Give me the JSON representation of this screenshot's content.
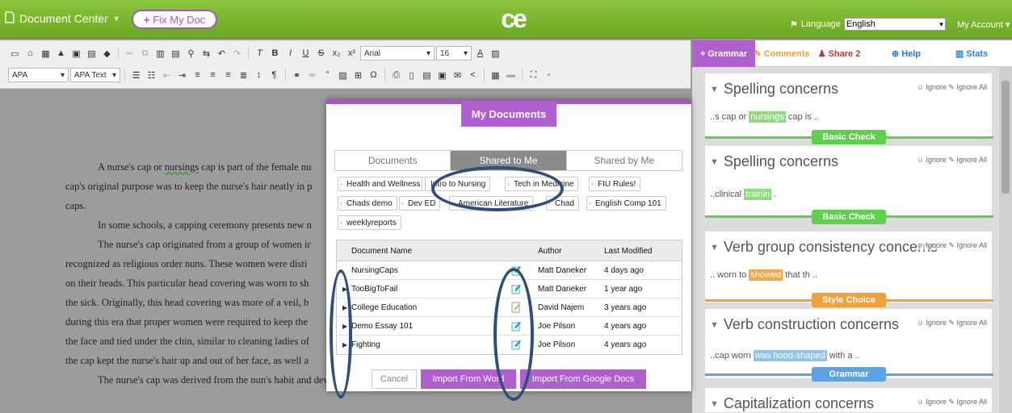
{
  "topbar": {
    "doc_center": "Document Center",
    "fix_button": "Fix My Doc",
    "logo": "ce",
    "language_label": "Language",
    "language_value": "English",
    "account": "My Account"
  },
  "toolbar": {
    "font_name": "Arial",
    "font_size": "16",
    "style_apa": "APA",
    "style_text": "APA Text"
  },
  "editor": {
    "lines": [
      {
        "text_a": "A nurse's cap or ",
        "squig": "nursings",
        "text_b": " cap is part of the female nu"
      },
      {
        "text": "cap's original purpose was to keep the nurse's hair neatly in p"
      },
      {
        "text": "caps."
      },
      {
        "text": "In some schools, a capping ceremony presents new n"
      },
      {
        "text": "The nurse's cap originated from a group of women ir"
      },
      {
        "text": "recognized as religious order nuns. These women were disti"
      },
      {
        "text": "on their heads. This particular head covering was worn to sh"
      },
      {
        "text": "the sick. Originally, this head covering was more of a veil, b"
      },
      {
        "text": "during this era that proper women were required to keep the"
      },
      {
        "text": "the face and tied under the chin, similar to cleaning ladies of"
      },
      {
        "text": "the cap kept the nurse's hair up and out of her face, as well a"
      },
      {
        "text": "The nurse's cap was derived from the nun's habit and developed over time into two types:"
      }
    ]
  },
  "right_panel": {
    "tabs": [
      "Grammar",
      "Comments",
      "Share 2",
      "Help",
      "Stats"
    ],
    "ignore": "Ignore",
    "ignore_all": "Ignore All",
    "cards": [
      {
        "title": "Spelling concerns",
        "pre": "..s cap or ",
        "hl": "nursings",
        "post": " cap is ..",
        "badge": "Basic Check",
        "color": "#5fcf4e"
      },
      {
        "title": "Spelling concerns",
        "pre": "..clinical ",
        "hl": "trainin",
        "post": " .",
        "badge": "Basic Check",
        "color": "#5fcf4e"
      },
      {
        "title": "Verb group consistency concerns",
        "pre": ".. worn to ",
        "hl": "showed",
        "post": " that th ..",
        "badge": "Style Choice",
        "color": "#f0a13a"
      },
      {
        "title": "Verb construction concerns",
        "pre": "..cap worn ",
        "hl": "was hood-shaped",
        "post": " with a ..",
        "badge": "Grammar",
        "color": "#5aa4e6"
      },
      {
        "title": "Capitalization concerns",
        "pre": "",
        "hl": "",
        "post": "",
        "badge": "",
        "color": "#5aa4e6"
      }
    ]
  },
  "modal": {
    "title": "My Documents",
    "tabs": [
      "Documents",
      "Shared to Me",
      "Shared by Me"
    ],
    "tags": [
      "Health and Wellness",
      "Intro to Nursing",
      "Tech in Medicine",
      "FIU Rules!",
      "Chads demo",
      "Dev ED",
      "American Literature",
      "Chad",
      "English Comp 101",
      "weeklyreports"
    ],
    "columns": [
      "Document Name",
      "Author",
      "Last Modified"
    ],
    "rows": [
      {
        "name": "NursingCaps",
        "author": "Matt Daneker",
        "modified": "4 days ago",
        "expand": false
      },
      {
        "name": "TooBigToFail",
        "author": "Matt Daneker",
        "modified": "1 year ago",
        "expand": true
      },
      {
        "name": "College Education",
        "author": "David Najem",
        "modified": "3 years ago",
        "expand": true
      },
      {
        "name": "Demo Essay 101",
        "author": "Joe Pilson",
        "modified": "4 years ago",
        "expand": true
      },
      {
        "name": "Fighting",
        "author": "Joe Pilson",
        "modified": "4 years ago",
        "expand": true
      }
    ],
    "cancel": "Cancel",
    "import_word": "Import From Word",
    "import_google": "Import From Google Docs"
  },
  "colors": {
    "green": "#7ab733",
    "purple": "#a656c4",
    "oval": "#2d4f7a"
  }
}
